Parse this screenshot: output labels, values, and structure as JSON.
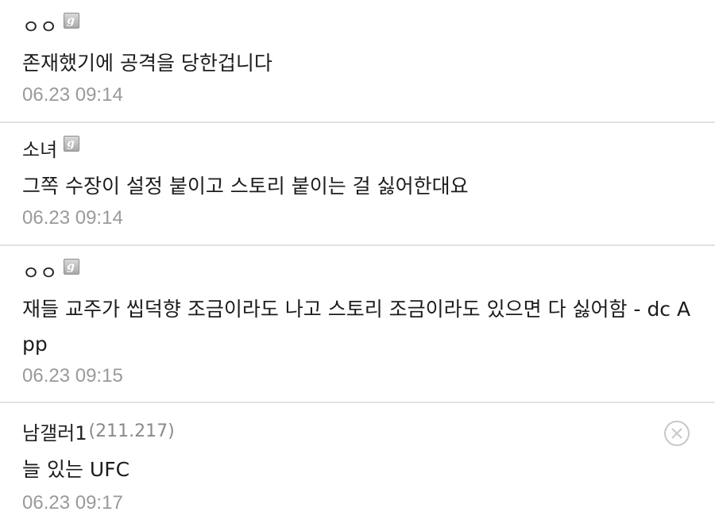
{
  "comments": [
    {
      "nickname": "ㅇㅇ",
      "has_badge": true,
      "text": "존재했기에 공격을 당한겁니다",
      "date": "06.23 09:14"
    },
    {
      "nickname": "소녀",
      "has_badge": true,
      "text": "그쪽 수장이 설정 붙이고 스토리 붙이는 걸 싫어한대요",
      "date": "06.23 09:14"
    },
    {
      "nickname": "ㅇㅇ",
      "has_badge": true,
      "text": "재들 교주가 씹덕향 조금이라도 나고 스토리 조금이라도 있으면 다 싫어함 - dc App",
      "date": "06.23 09:15"
    },
    {
      "nickname": "남갤러1",
      "ip": "(211.217)",
      "has_badge": false,
      "text": "늘 있는 UFC",
      "date": "06.23 09:17",
      "delete_icon": "close-circle-icon"
    }
  ],
  "colors": {
    "date": "#9a9a9a",
    "ip": "#8a8a8a",
    "divider": "#e2e2e2",
    "delete_icon": "#c8c8c8"
  }
}
